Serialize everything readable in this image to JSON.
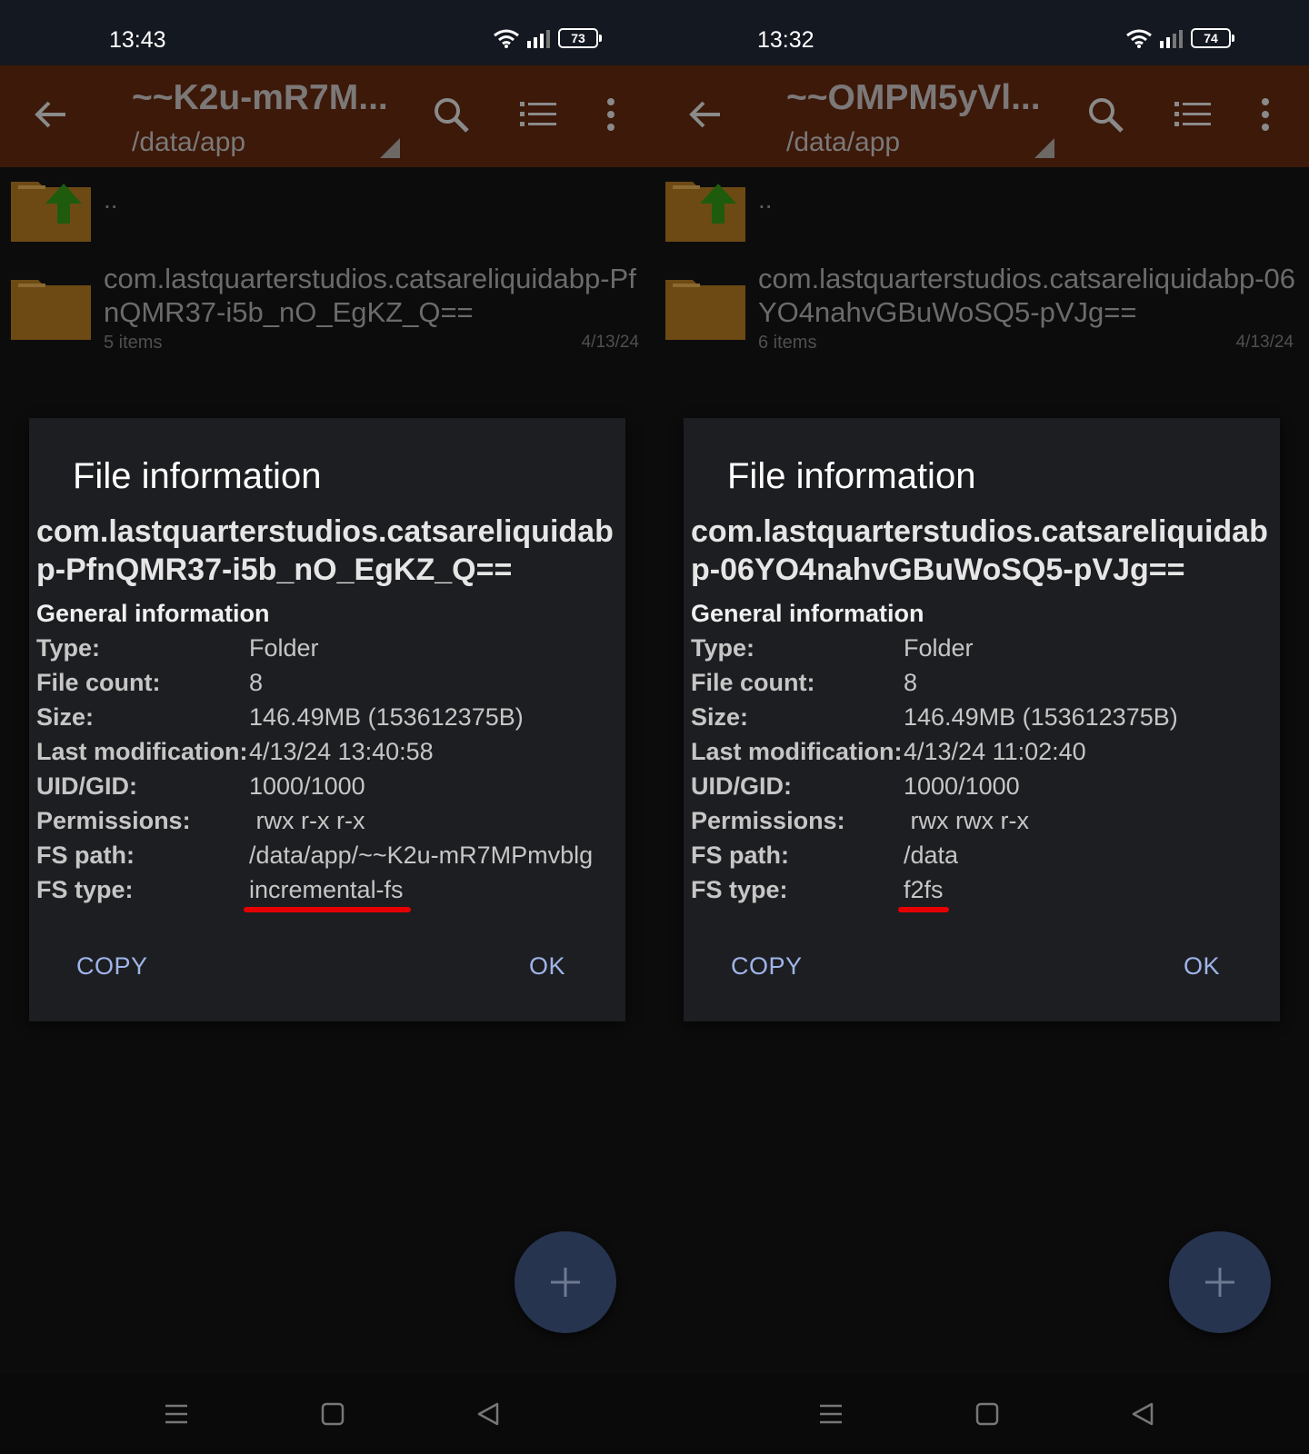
{
  "screens": [
    {
      "status": {
        "time": "13:43",
        "battery": "73"
      },
      "toolbar": {
        "title": "~~K2u-mR7M...",
        "path": "/data/app"
      },
      "list": {
        "up_label": "..",
        "item": {
          "name": "com.lastquarterstudios.catsareliquidabp-PfnQMR37-i5b_nO_EgKZ_Q==",
          "count": "5 items",
          "date": "4/13/24"
        }
      },
      "dialog": {
        "title": "File information",
        "name": "com.lastquarterstudios.catsareliquidabp-PfnQMR37-i5b_nO_EgKZ_Q==",
        "section": "General information",
        "rows": [
          {
            "key": "Type:",
            "value": "Folder"
          },
          {
            "key": "File count:",
            "value": "8"
          },
          {
            "key": "Size:",
            "value": "146.49MB (153612375B)"
          },
          {
            "key": "Last modification:",
            "value": "4/13/24 13:40:58"
          },
          {
            "key": "UID/GID:",
            "value": "1000/1000"
          },
          {
            "key": "Permissions:",
            "value": " rwx r-x r-x"
          },
          {
            "key": "FS path:",
            "value": "/data/app/~~K2u-mR7MPmvblg"
          },
          {
            "key": "FS type:",
            "value": "incremental-fs"
          }
        ],
        "copy_label": "COPY",
        "ok_label": "OK"
      }
    },
    {
      "status": {
        "time": "13:32",
        "battery": "74"
      },
      "toolbar": {
        "title": "~~OMPM5yVl...",
        "path": "/data/app"
      },
      "list": {
        "up_label": "..",
        "item": {
          "name": "com.lastquarterstudios.catsareliquidabp-06YO4nahvGBuWoSQ5-pVJg==",
          "count": "6 items",
          "date": "4/13/24"
        }
      },
      "dialog": {
        "title": "File information",
        "name": "com.lastquarterstudios.catsareliquidabp-06YO4nahvGBuWoSQ5-pVJg==",
        "section": "General information",
        "rows": [
          {
            "key": "Type:",
            "value": "Folder"
          },
          {
            "key": "File count:",
            "value": "8"
          },
          {
            "key": "Size:",
            "value": "146.49MB (153612375B)"
          },
          {
            "key": "Last modification:",
            "value": "4/13/24 11:02:40"
          },
          {
            "key": "UID/GID:",
            "value": "1000/1000"
          },
          {
            "key": "Permissions:",
            "value": " rwx rwx r-x"
          },
          {
            "key": "FS path:",
            "value": "/data"
          },
          {
            "key": "FS type:",
            "value": "f2fs"
          }
        ],
        "copy_label": "COPY",
        "ok_label": "OK"
      }
    }
  ],
  "colors": {
    "toolbar": "#3c1909",
    "dialog": "#1d1e21",
    "button_text": "#9fb4ea",
    "annotation_underline": "#e60000",
    "fab": "#263450"
  },
  "icons": [
    "back-arrow-icon",
    "search-icon",
    "list-view-icon",
    "more-vert-icon",
    "folder-up-icon",
    "folder-icon",
    "plus-icon",
    "menu-icon",
    "home-icon",
    "back-nav-icon",
    "wifi-icon",
    "signal-icon",
    "battery-icon"
  ]
}
